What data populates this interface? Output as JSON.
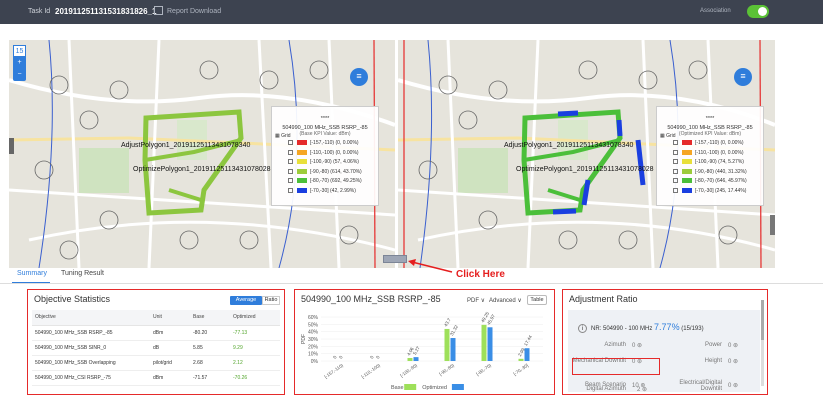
{
  "topbar": {
    "task_label": "Task Id",
    "task_id": "201911251131531831826_1",
    "report_download": "Report Download",
    "association_label": "Association",
    "association_on": true
  },
  "map_left": {
    "zoom_level": "15",
    "zoom_in": "+",
    "zoom_out": "−",
    "polygon1": "AdjustPolygon1_20191125113431078340",
    "polygon2": "OptimizePolygon1_20191125113431078028",
    "legend": {
      "dots": "****",
      "title": "504990_100 MHz_SSB RSRP_-85",
      "subtitle": "(Base KPI Value: dBm)",
      "grid_label": "Grid",
      "rows": [
        {
          "range": "[-157,-110)",
          "value": "(0, 0.00%)",
          "color": "#e52a2a"
        },
        {
          "range": "[-110,-100)",
          "value": "(0, 0.00%)",
          "color": "#f5a623"
        },
        {
          "range": "[-100,-90)",
          "value": "(57, 4.06%)",
          "color": "#e8e03a"
        },
        {
          "range": "[-90,-80)",
          "value": "(614, 43.70%)",
          "color": "#9ccc3a"
        },
        {
          "range": "[-80,-70)",
          "value": "(692, 49.25%)",
          "color": "#4bbf3a"
        },
        {
          "range": "[-70,-30]",
          "value": "(42, 2.99%)",
          "color": "#1a3fe0"
        }
      ]
    }
  },
  "map_right": {
    "polygon1": "AdjustPolygon1_20191125113431078340",
    "polygon2": "OptimizePolygon1_20191125113431078028",
    "legend": {
      "dots": "****",
      "title": "504990_100 MHz_SSB RSRP_-85",
      "subtitle": "(Optimized KPI Value: dBm)",
      "grid_label": "Grid",
      "rows": [
        {
          "range": "[-157,-110)",
          "value": "(0, 0.00%)",
          "color": "#e52a2a"
        },
        {
          "range": "[-110,-100)",
          "value": "(0, 0.00%)",
          "color": "#f5a623"
        },
        {
          "range": "[-100,-90)",
          "value": "(74, 5.27%)",
          "color": "#e8e03a"
        },
        {
          "range": "[-90,-80)",
          "value": "(440, 31.32%)",
          "color": "#9ccc3a"
        },
        {
          "range": "[-80,-70)",
          "value": "(646, 45.97%)",
          "color": "#4bbf3a"
        },
        {
          "range": "[-70,-30]",
          "value": "(245, 17.44%)",
          "color": "#1a3fe0"
        }
      ]
    }
  },
  "click_here": "Click Here",
  "tabs": [
    "Summary",
    "Tuning Result"
  ],
  "objective": {
    "title": "Objective Statistics",
    "btn_average": "Average",
    "btn_ratio": "Ratio",
    "headers": [
      "Objective",
      "Unit",
      "Base",
      "Optimized"
    ],
    "rows": [
      [
        "504990_100 MHz_SSB RSRP_-85",
        "dBm",
        "-80.20",
        "-77.13"
      ],
      [
        "504990_100 MHz_SSB SINR_0",
        "dB",
        "5.85",
        "9.29"
      ],
      [
        "504990_100 MHz_SSB Overlapping",
        "pilot/grid",
        "2.68",
        "2.12"
      ],
      [
        "504990_100 MHz_CSI RSRP_-75",
        "dBm",
        "-71.57",
        "-70.26"
      ]
    ]
  },
  "pdf_panel": {
    "title": "504990_100 MHz_SSB RSRP_-85",
    "pdf_select": "PDF",
    "advanced_select": "Advanced",
    "table_button": "Table"
  },
  "chart_data": {
    "type": "bar",
    "ylabel": "PDF",
    "ylim": [
      0,
      60
    ],
    "y_ticks": [
      "0%",
      "10%",
      "20%",
      "30%",
      "40%",
      "50%",
      "60%"
    ],
    "categories": [
      "[-157,-110)",
      "[-110,-100)",
      "[-100,-90)",
      "[-90,-80)",
      "[-80,-70)",
      "[-70,-30]"
    ],
    "series": [
      {
        "name": "Base",
        "values": [
          0,
          0,
          4.06,
          43.7,
          49.25,
          2.99
        ],
        "labels": [
          "0",
          "0",
          "4.06",
          "43.7",
          "49.25",
          "2.99"
        ],
        "color": "#9ee05a"
      },
      {
        "name": "Optimized",
        "values": [
          0,
          0,
          5.27,
          31.32,
          45.97,
          17.44
        ],
        "labels": [
          "0",
          "0",
          "5.27",
          "31.32",
          "45.97",
          "17.44"
        ],
        "color": "#3a8ee6"
      }
    ],
    "legend": "bottom"
  },
  "adjustment": {
    "title": "Adjustment Ratio",
    "nr_label": "NR: 504990 - 100 MHz",
    "nr_percent": "7.77%",
    "nr_count": "(15/193)",
    "items": [
      {
        "label": "Azimuth",
        "value": "0"
      },
      {
        "label": "Power",
        "value": "0"
      },
      {
        "label": "Mechanical Downtilt",
        "value": "0"
      },
      {
        "label": "Height",
        "value": "0"
      },
      {
        "label": "Beam Scenario",
        "value": "10"
      },
      {
        "label": "Electrical/Digital Downtilt",
        "value": "0"
      },
      {
        "label": "Digital Azimuth",
        "value": "2"
      }
    ]
  }
}
